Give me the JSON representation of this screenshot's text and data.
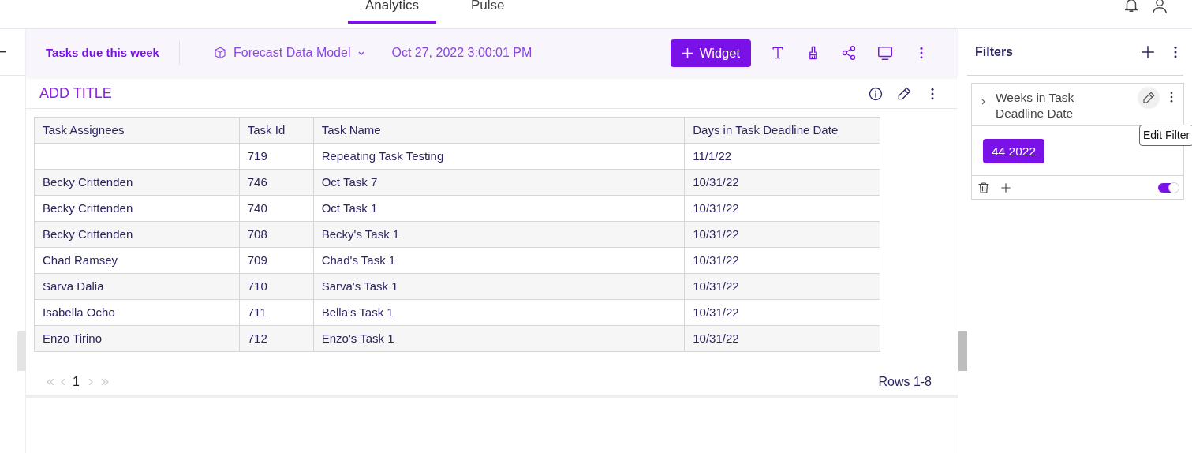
{
  "top_tabs": [
    {
      "label": "Analytics",
      "selected": true
    },
    {
      "label": "Pulse",
      "selected": false
    }
  ],
  "toolbar": {
    "dashboard_title": "Tasks due this week",
    "data_model": "Forecast Data Model",
    "timestamp": "Oct 27, 2022 3:00:01 PM",
    "widget_button": "Widget"
  },
  "widget": {
    "title": "ADD TITLE",
    "table": {
      "columns": [
        "Task Assignees",
        "Task Id",
        "Task Name",
        "Days in Task Deadline Date"
      ],
      "rows": [
        [
          "",
          "719",
          "Repeating Task Testing",
          "11/1/22"
        ],
        [
          "Becky Crittenden",
          "746",
          "Oct Task 7",
          "10/31/22"
        ],
        [
          "Becky Crittenden",
          "740",
          "Oct Task 1",
          "10/31/22"
        ],
        [
          "Becky Crittenden",
          "708",
          "Becky's Task 1",
          "10/31/22"
        ],
        [
          "Chad Ramsey",
          "709",
          "Chad's Task 1",
          "10/31/22"
        ],
        [
          "Sarva Dalia",
          "710",
          "Sarva's Task 1",
          "10/31/22"
        ],
        [
          "Isabella Ocho",
          "711",
          "Bella's Task 1",
          "10/31/22"
        ],
        [
          "Enzo Tirino",
          "712",
          "Enzo's Task 1",
          "10/31/22"
        ]
      ]
    },
    "pagination": {
      "page": "1",
      "rows_label": "Rows 1-8"
    }
  },
  "filters_panel": {
    "title": "Filters",
    "filters": [
      {
        "name": "Weeks in Task Deadline Date",
        "value": "44 2022",
        "expanded": false,
        "on": true,
        "tooltip": "Edit Filter"
      }
    ]
  }
}
